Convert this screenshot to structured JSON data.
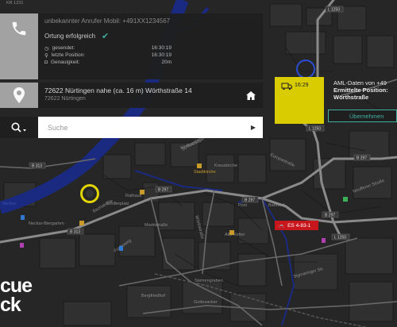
{
  "caller": {
    "title": "unbekannter Anrufer Mobil: +491XX1234567",
    "status": "Ortung erfolgreich",
    "rows": [
      {
        "label": "gesendet:",
        "value": "16:30:19"
      },
      {
        "label": "letzte Position:",
        "value": "16:30:19"
      },
      {
        "label": "Genauigkeit:",
        "value": "20m"
      }
    ]
  },
  "address": {
    "main": "72622 Nürtingen nahe (ca. 16 m) Wörthstraße 14",
    "sub": "72622 Nürtingen"
  },
  "search": {
    "placeholder": "Suche"
  },
  "aml": {
    "time": "16:29",
    "line1": "AML-Daten von +49",
    "line2": "Ermittelte Position:",
    "line3": "Wörthstraße",
    "button": "Übernehmen"
  },
  "vehicle": {
    "label": "ES 4-83-1"
  },
  "logo": {
    "line1": "cue",
    "line2": "ck"
  },
  "map_labels": {
    "kr": "KR 1231",
    "stadtkirche": "Stadtkirche",
    "rathaus": "Rathaus",
    "kreuzkirche": "Kreuzkirche",
    "neckar": "Neckar",
    "neckarbierg": "Neckar-Biergarten",
    "bachstr": "Bachstraße",
    "marktstr": "Marktstraße",
    "wörthstr": "Wörthstraße",
    "schillerpl": "Schillerplatz",
    "post": "Post",
    "bahnhof": "Bahnhof",
    "europastr": "Europastraße",
    "kirchstr": "Kirchstraße",
    "alte_kelter": "Alte Kelter",
    "neuffener": "Neuffener Straße",
    "steinengr": "Steinengraben",
    "sigmaringer": "Sigmaringer Str.",
    "bergfried": "Bergfriedhof",
    "gottesacker": "Gottesacker",
    "fuchs": "Fuchsweg",
    "schlossberg": "Schlossbergstraße",
    "b313a": "B 313",
    "b313b": "B 313",
    "b297a": "B 297",
    "b297b": "B 297",
    "b297c": "B 297",
    "b297d": "B 297",
    "l1250a": "L 1250",
    "l1250b": "L 1250",
    "l1250c": "L 1250"
  }
}
